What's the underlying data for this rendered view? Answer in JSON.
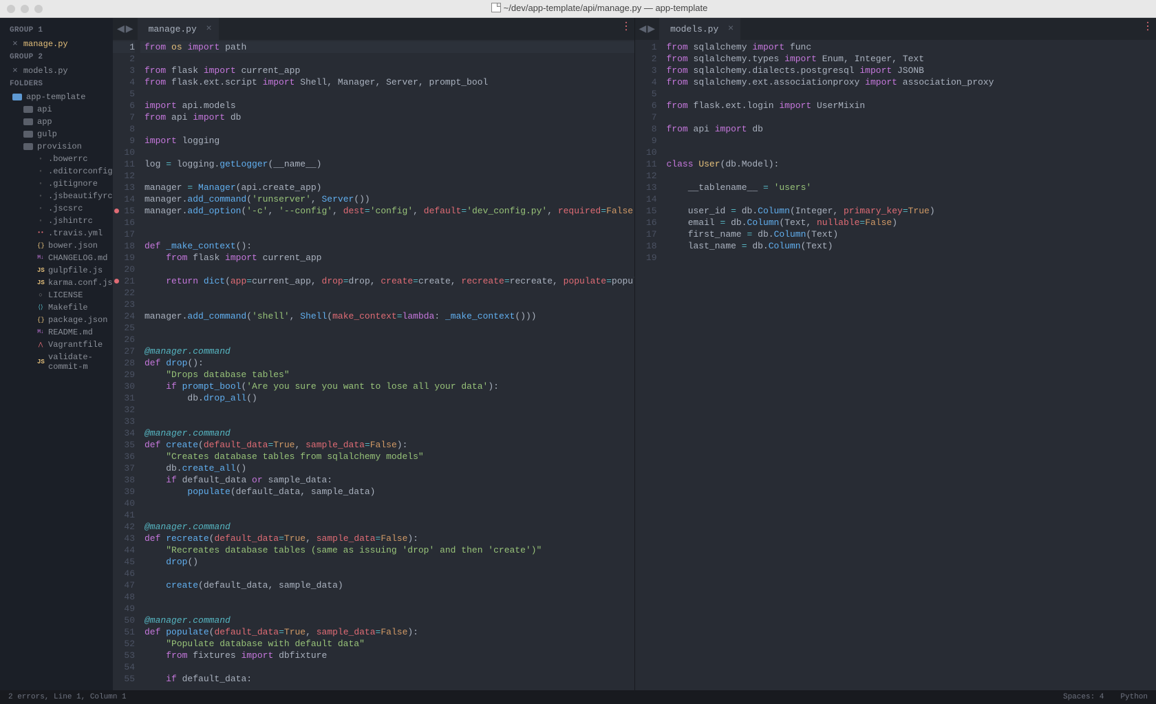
{
  "window": {
    "title": "~/dev/app-template/api/manage.py — app-template"
  },
  "sidebar": {
    "groups": [
      {
        "label": "GROUP 1",
        "items": [
          {
            "name": "manage.py",
            "active": true
          }
        ]
      },
      {
        "label": "GROUP 2",
        "items": [
          {
            "name": "models.py",
            "active": false
          }
        ]
      }
    ],
    "folders_label": "FOLDERS",
    "tree": {
      "root": "app-template",
      "dirs": [
        "api",
        "app",
        "gulp",
        "provision"
      ],
      "files": [
        {
          "icon": "gear",
          "name": ".bowerrc"
        },
        {
          "icon": "gear",
          "name": ".editorconfig"
        },
        {
          "icon": "gear",
          "name": ".gitignore"
        },
        {
          "icon": "gear",
          "name": ".jsbeautifyrc"
        },
        {
          "icon": "gear",
          "name": ".jscsrc"
        },
        {
          "icon": "gear",
          "name": ".jshintrc"
        },
        {
          "icon": "yml",
          "name": ".travis.yml"
        },
        {
          "icon": "json",
          "name": "bower.json"
        },
        {
          "icon": "md",
          "name": "CHANGELOG.md"
        },
        {
          "icon": "js",
          "name": "gulpfile.js"
        },
        {
          "icon": "js",
          "name": "karma.conf.js"
        },
        {
          "icon": "lic",
          "name": "LICENSE"
        },
        {
          "icon": "mk",
          "name": "Makefile"
        },
        {
          "icon": "json",
          "name": "package.json"
        },
        {
          "icon": "md",
          "name": "README.md"
        },
        {
          "icon": "rb",
          "name": "Vagrantfile"
        },
        {
          "icon": "js",
          "name": "validate-commit-m"
        }
      ]
    }
  },
  "panes": [
    {
      "tab": "manage.py",
      "tab_active": true
    },
    {
      "tab": "models.py",
      "tab_active": true
    }
  ],
  "status": {
    "left": "2 errors, Line 1, Column 1",
    "spaces": "Spaces: 4",
    "lang": "Python"
  },
  "code_left_lines": 55,
  "code_right_lines": 19
}
